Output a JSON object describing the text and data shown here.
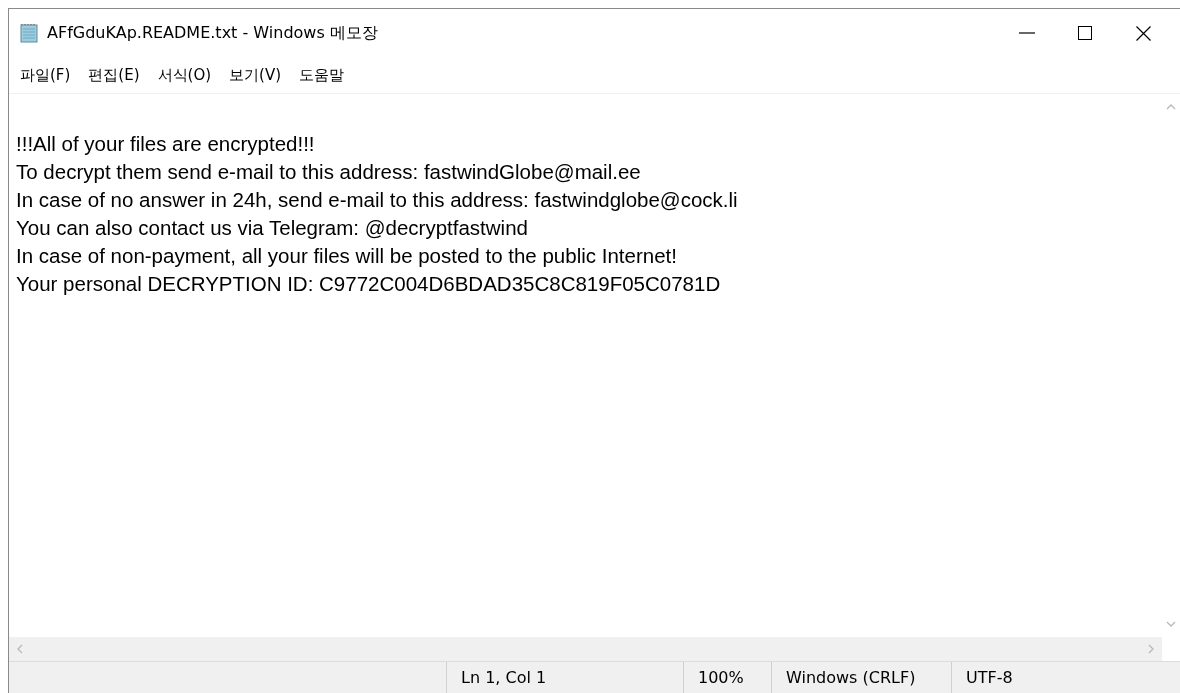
{
  "window": {
    "title": "AFfGduKAp.README.txt - Windows 메모장",
    "controls": [
      {
        "kind": "minimize"
      },
      {
        "kind": "maximize"
      },
      {
        "kind": "close"
      }
    ]
  },
  "menu": [
    "파일(F)",
    "편집(E)",
    "서식(O)",
    "보기(V)",
    "도움말"
  ],
  "document": {
    "lines": [
      "!!!All of your files are encrypted!!!",
      "To decrypt them send e-mail to this address: fastwindGlobe@mail.ee",
      "In case of no answer in 24h, send e-mail to this address: fastwindglobe@cock.li",
      "You can also contact us via Telegram: @decryptfastwind",
      "In case of non-payment, all your files will be posted to the public Internet!",
      "Your personal DECRYPTION ID: C9772C004D6BDAD35C8C819F05C0781D"
    ]
  },
  "status_bar": [
    "Ln 1, Col 1",
    "100%",
    "Windows (CRLF)",
    "UTF-8"
  ]
}
